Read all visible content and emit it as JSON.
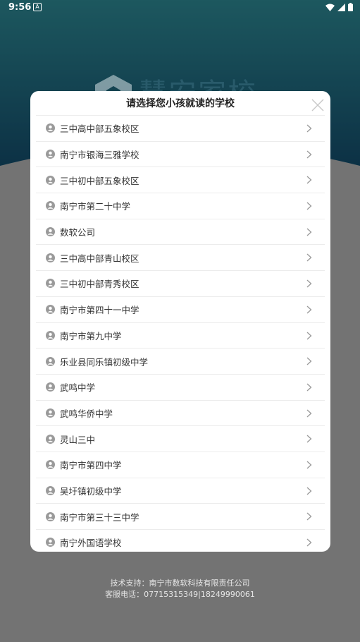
{
  "colors": {
    "header_top": "#2f8fa0",
    "header_bottom": "#1b5f82",
    "overlay": "#737373",
    "accent_icon": "#9a9a9a"
  },
  "status_bar": {
    "time": "9:56",
    "badge": "A"
  },
  "brand": {
    "title": "慧安家校"
  },
  "dialog": {
    "title": "请选择您小孩就读的学校",
    "schools": [
      {
        "name": "三中高中部五象校区"
      },
      {
        "name": "南宁市银海三雅学校"
      },
      {
        "name": "三中初中部五象校区"
      },
      {
        "name": "南宁市第二十中学"
      },
      {
        "name": "数软公司"
      },
      {
        "name": "三中高中部青山校区"
      },
      {
        "name": "三中初中部青秀校区"
      },
      {
        "name": "南宁市第四十一中学"
      },
      {
        "name": "南宁市第九中学"
      },
      {
        "name": "乐业县同乐镇初级中学"
      },
      {
        "name": "武鸣中学"
      },
      {
        "name": "武鸣华侨中学"
      },
      {
        "name": "灵山三中"
      },
      {
        "name": "南宁市第四中学"
      },
      {
        "name": "吴圩镇初级中学"
      },
      {
        "name": "南宁市第三十三中学"
      },
      {
        "name": "南宁外国语学校"
      }
    ]
  },
  "footer": {
    "support": "技术支持：南宁市数软科技有限责任公司",
    "phone": "客服电话：07715315349|18249990061"
  }
}
